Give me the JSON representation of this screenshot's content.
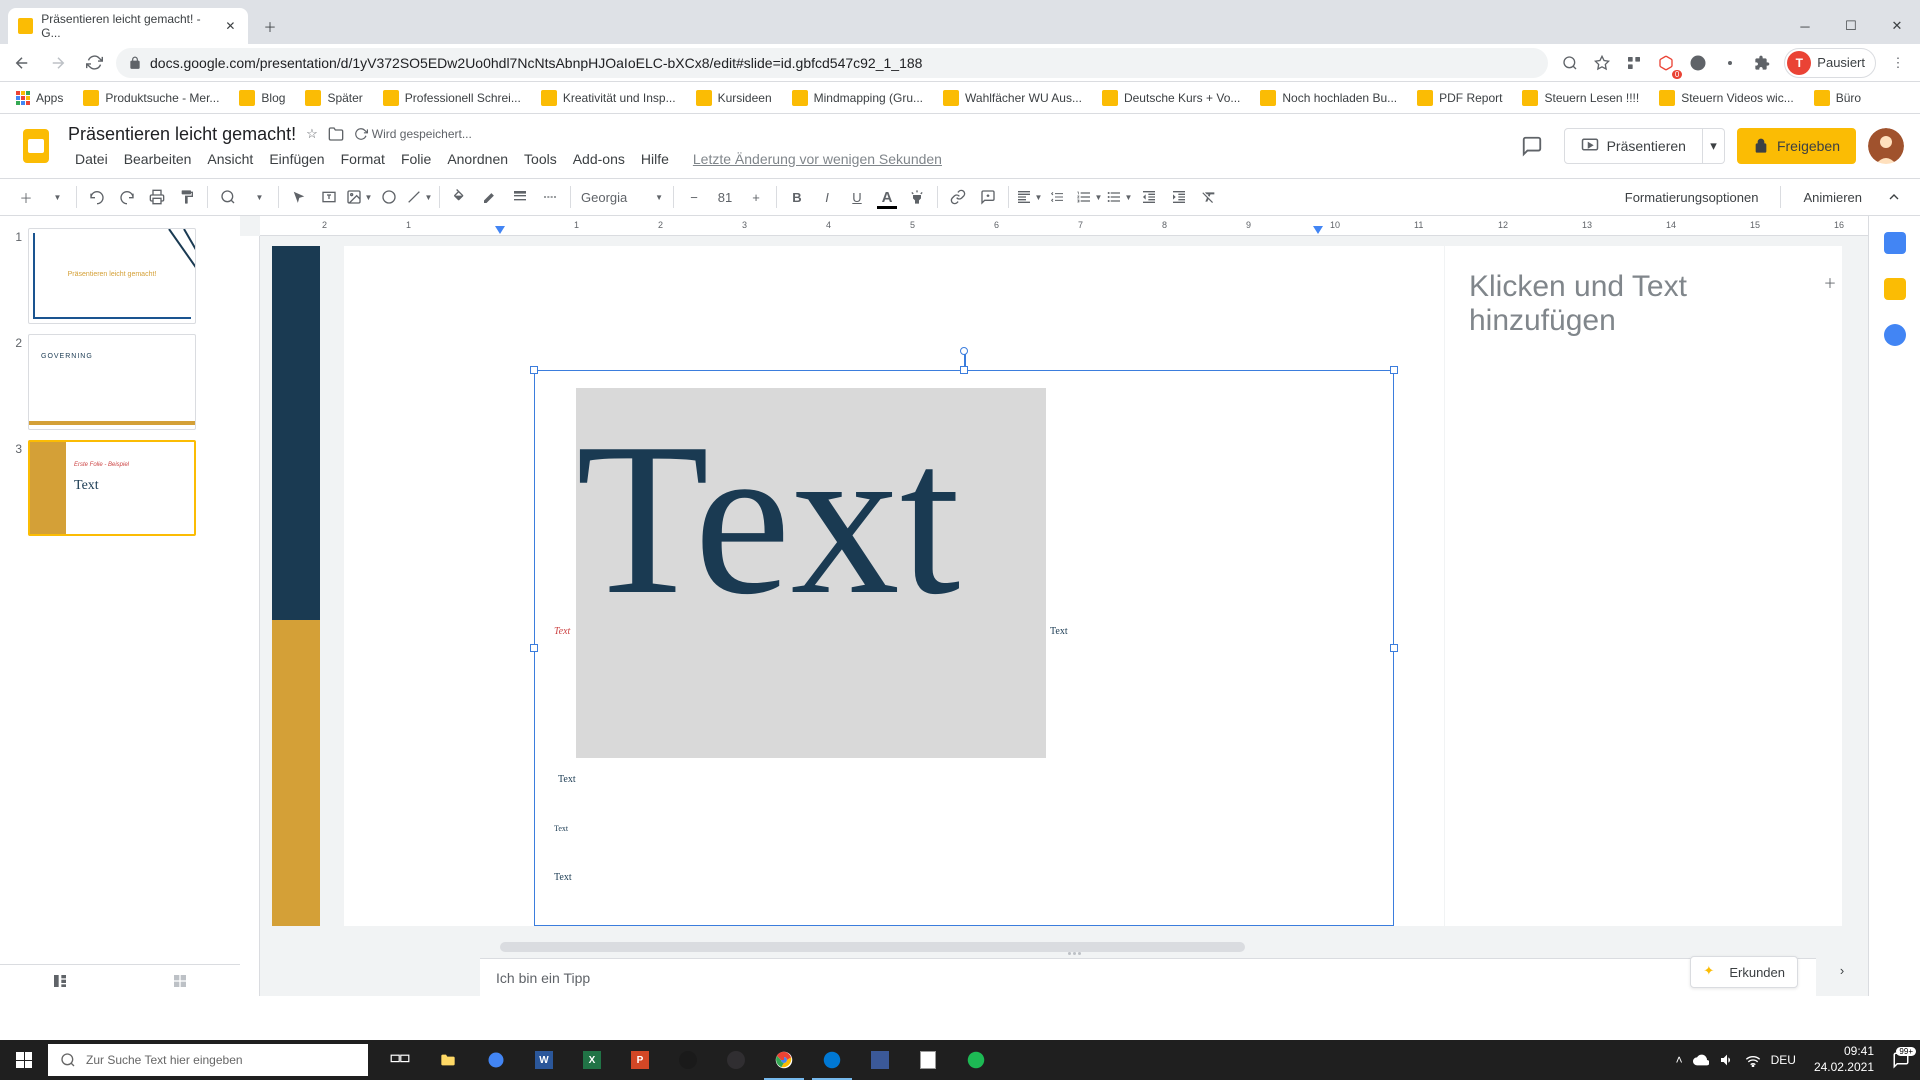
{
  "browser": {
    "tab_title": "Präsentieren leicht gemacht! - G...",
    "url": "docs.google.com/presentation/d/1yV372SO5EDw2Uo0hdl7NcNtsAbnpHJOaIoELC-bXCx8/edit#slide=id.gbfcd547c92_1_188",
    "paused": "Pausiert",
    "profile_initial": "T"
  },
  "bookmarks": [
    {
      "label": "Apps",
      "icon": "grid"
    },
    {
      "label": "Produktsuche - Mer...",
      "icon": "y"
    },
    {
      "label": "Blog",
      "icon": "y"
    },
    {
      "label": "Später",
      "icon": "y"
    },
    {
      "label": "Professionell Schrei...",
      "icon": "y"
    },
    {
      "label": "Kreativität und Insp...",
      "icon": "y"
    },
    {
      "label": "Kursideen",
      "icon": "y"
    },
    {
      "label": "Mindmapping (Gru...",
      "icon": "y"
    },
    {
      "label": "Wahlfächer WU Aus...",
      "icon": "y"
    },
    {
      "label": "Deutsche Kurs + Vo...",
      "icon": "y"
    },
    {
      "label": "Noch hochladen Bu...",
      "icon": "y"
    },
    {
      "label": "PDF Report",
      "icon": "y"
    },
    {
      "label": "Steuern Lesen !!!!",
      "icon": "y"
    },
    {
      "label": "Steuern Videos wic...",
      "icon": "y"
    },
    {
      "label": "Büro",
      "icon": "y"
    }
  ],
  "doc": {
    "title": "Präsentieren leicht gemacht!",
    "save_status": "Wird gespeichert...",
    "last_change": "Letzte Änderung vor wenigen Sekunden"
  },
  "menus": [
    "Datei",
    "Bearbeiten",
    "Ansicht",
    "Einfügen",
    "Format",
    "Folie",
    "Anordnen",
    "Tools",
    "Add-ons",
    "Hilfe"
  ],
  "header": {
    "present": "Präsentieren",
    "share": "Freigeben"
  },
  "toolbar": {
    "font": "Georgia",
    "font_size": "81",
    "format_options": "Formatierungsoptionen",
    "animate": "Animieren"
  },
  "ruler_marks": [
    "2",
    "1",
    "",
    "1",
    "2",
    "3",
    "4",
    "5",
    "6",
    "7",
    "8",
    "9",
    "10",
    "11",
    "12",
    "13",
    "14",
    "15",
    "16"
  ],
  "slide": {
    "big_text": "Text",
    "small1": "Text",
    "small2": "Text",
    "small3": "Text",
    "small4": "Text",
    "small5": "Text",
    "placeholder": "Klicken und Text hinzufügen"
  },
  "filmstrip": {
    "t1_title": "Präsentieren leicht gemacht!",
    "t2_text": "GOVERNING",
    "t3_title": "Erste Folie - Beispiel",
    "t3_text": "Text"
  },
  "speaker_notes": "Ich bin ein Tipp",
  "explore": "Erkunden",
  "taskbar": {
    "search_placeholder": "Zur Suche Text hier eingeben",
    "lang": "DEU",
    "time": "09:41",
    "date": "24.02.2021",
    "notify": "99+"
  }
}
